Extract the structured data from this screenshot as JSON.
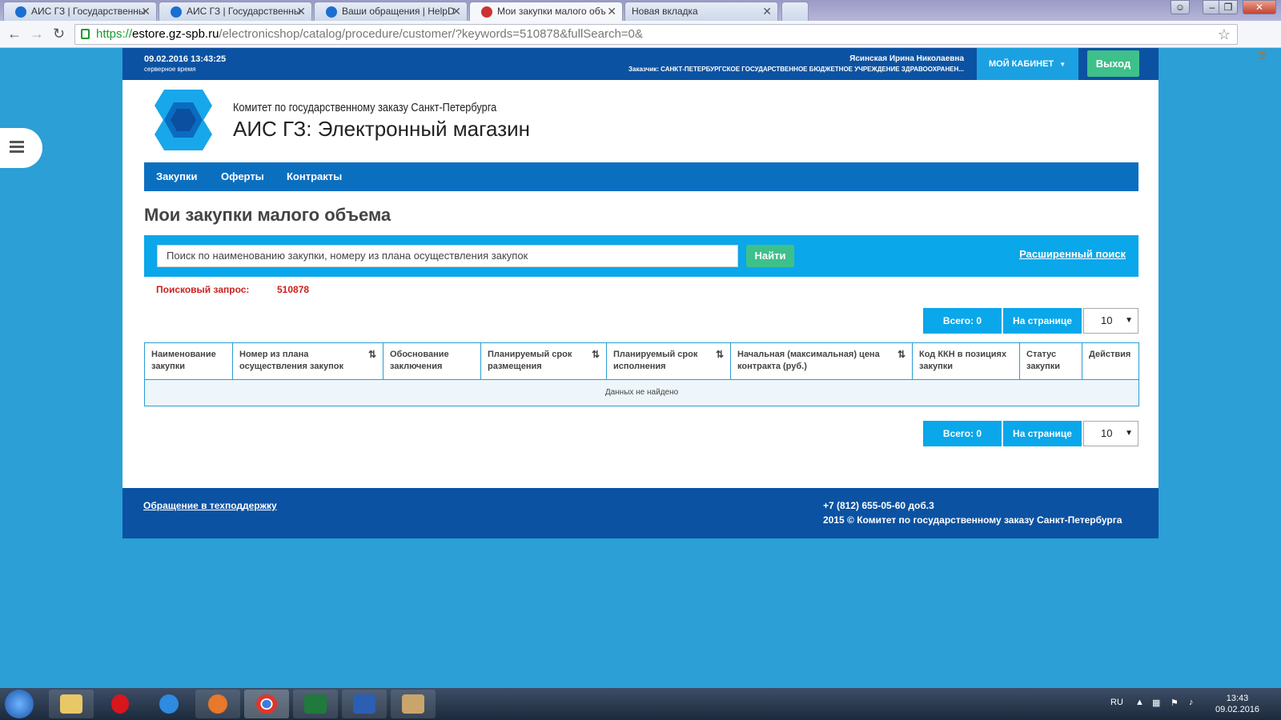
{
  "browser": {
    "tabs": [
      {
        "title": "АИС ГЗ | Государственны"
      },
      {
        "title": "АИС ГЗ | Государственны"
      },
      {
        "title": "Ваши обращения | HelpD"
      },
      {
        "title": "Мои закупки малого объ"
      },
      {
        "title": "Новая вкладка"
      }
    ],
    "url_scheme": "https://",
    "url_host": "estore.gz-spb.ru",
    "url_path": "/electronicshop/catalog/procedure/customer/?keywords=510878&fullSearch=0&"
  },
  "header": {
    "server_datetime": "09.02.2016 13:43:25",
    "server_time_label": "серверное время",
    "user_name": "Ясинская Ирина Николаевна",
    "customer": "Заказчик: САНКТ-ПЕТЕРБУРГСКОЕ ГОСУДАРСТВЕННОЕ БЮДЖЕТНОЕ УЧРЕЖДЕНИЕ ЗДРАВООХРАНЕН...",
    "cabinet_label": "МОЙ КАБИНЕТ",
    "logout_label": "Выход"
  },
  "brand": {
    "organization": "Комитет по государственному заказу Санкт-Петербурга",
    "app_name": "АИС ГЗ: Электронный магазин"
  },
  "nav": {
    "items": [
      {
        "label": "Закупки"
      },
      {
        "label": "Оферты"
      },
      {
        "label": "Контракты"
      }
    ]
  },
  "page": {
    "title": "Мои закупки малого объема",
    "search_placeholder": "Поиск по наименованию закупки, номеру из плана осуществления закупок",
    "search_button": "Найти",
    "advanced_search": "Расширенный поиск",
    "query_label": "Поисковый запрос:",
    "query_value": "510878"
  },
  "pager": {
    "total_label": "Всего: 0",
    "per_page_label": "На странице",
    "per_page_value": "10"
  },
  "table": {
    "columns": [
      {
        "label": "Наименование закупки"
      },
      {
        "label": "Номер из плана осуществления закупок"
      },
      {
        "label": "Обоснование заключения"
      },
      {
        "label": "Планируемый срок размещения"
      },
      {
        "label": "Планируемый срок исполнения"
      },
      {
        "label": "Начальная (максимальная) цена контракта (руб.)"
      },
      {
        "label": "Код ККН в позициях закупки"
      },
      {
        "label": "Статус закупки"
      },
      {
        "label": "Действия"
      }
    ],
    "empty_message": "Данных не найдено"
  },
  "footer": {
    "support_link": "Обращение в техподдержку",
    "phone": "+7 (812) 655-05-60 доб.3",
    "copyright": "2015 © Комитет по государственному заказу Санкт-Петербурга"
  },
  "taskbar": {
    "language": "RU",
    "time": "13:43",
    "date": "09.02.2016",
    "apps": [
      "explorer-icon",
      "opera-icon",
      "internet-explorer-icon",
      "firefox-icon",
      "chrome-icon",
      "excel-icon",
      "word-icon",
      "paint-icon"
    ]
  },
  "colors": {
    "page_background": "#2b9fd6",
    "header_blue": "#0b52a2",
    "nav_blue": "#0b6fc0",
    "accent_cyan": "#0aa7ea",
    "green_button": "#3ec08b",
    "query_red": "#cc1f1f"
  }
}
